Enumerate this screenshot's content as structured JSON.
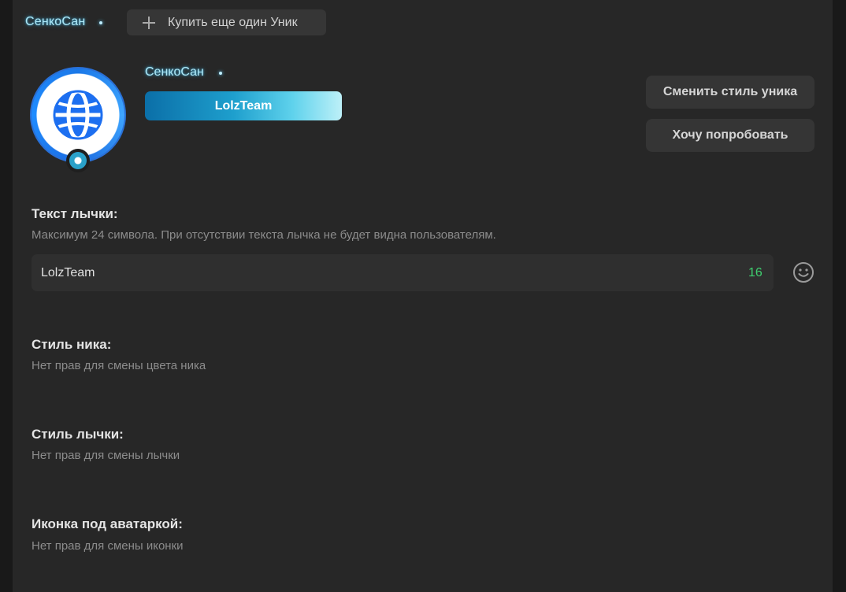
{
  "top_bar": {
    "nick": "СенкоСан",
    "buy_button_label": "Купить еще один Уник"
  },
  "preview": {
    "nick": "СенкоСан",
    "banner_text": "LolzTeam",
    "colors": {
      "nick_glow": "#46c8ff",
      "banner_gradient": [
        "#0b6fa8",
        "#1e9fcd",
        "#5fd2ec",
        "#bdf0f8"
      ]
    }
  },
  "actions": {
    "change_style_label": "Сменить стиль уника",
    "try_label": "Хочу попробовать"
  },
  "banner_text_section": {
    "title": "Текст лычки:",
    "description": "Максимум 24 символа. При отсутствии текста лычка не будет видна пользователям.",
    "input_value": "LolzTeam",
    "remaining_count": "16",
    "counter_color": "#3fcf6f"
  },
  "nick_style_section": {
    "title": "Стиль ника:",
    "description": "Нет прав для смены цвета ника"
  },
  "banner_style_section": {
    "title": "Стиль лычки:",
    "description": "Нет прав для смены лычки"
  },
  "avatar_icon_section": {
    "title": "Иконка под аватаркой:",
    "description": "Нет прав для смены иконки"
  }
}
